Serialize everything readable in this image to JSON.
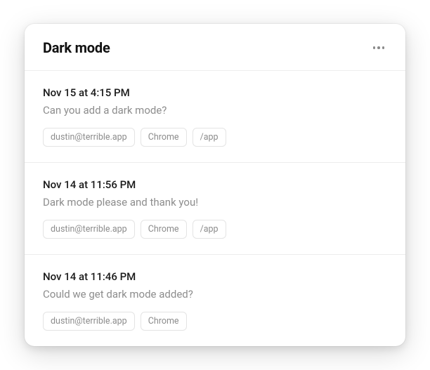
{
  "header": {
    "title": "Dark mode"
  },
  "items": [
    {
      "timestamp": "Nov 15 at 4:15 PM",
      "message": "Can you add a dark mode?",
      "tags": [
        "dustin@terrible.app",
        "Chrome",
        "/app"
      ]
    },
    {
      "timestamp": "Nov 14 at 11:56 PM",
      "message": "Dark mode please and thank you!",
      "tags": [
        "dustin@terrible.app",
        "Chrome",
        "/app"
      ]
    },
    {
      "timestamp": "Nov 14 at 11:46 PM",
      "message": "Could we get dark mode added?",
      "tags": [
        "dustin@terrible.app",
        "Chrome"
      ]
    }
  ]
}
